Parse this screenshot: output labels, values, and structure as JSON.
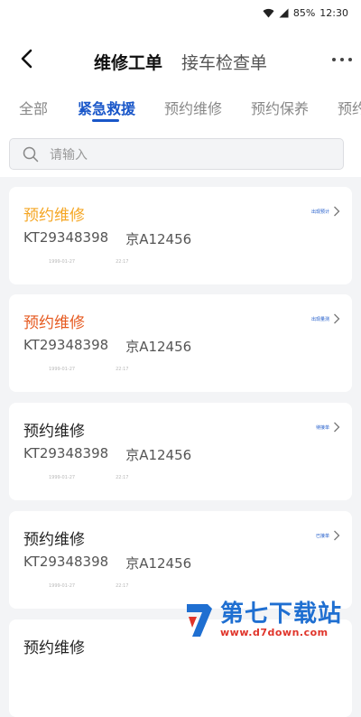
{
  "status_bar": {
    "battery": "85%",
    "time": "12:30"
  },
  "header": {
    "title": "维修工单",
    "alt_title": "接车检查单"
  },
  "tabs": [
    {
      "label": "全部"
    },
    {
      "label": "紧急救援"
    },
    {
      "label": "预约维修"
    },
    {
      "label": "预约保养"
    },
    {
      "label": "预约"
    }
  ],
  "search": {
    "placeholder": "请输入",
    "value": ""
  },
  "cards": [
    {
      "title": "预约维修",
      "order_no": "KT29348398",
      "plate": "京A12456",
      "date": "1999-01-27",
      "time": "22:17",
      "status": "出现预计"
    },
    {
      "title": "预约维修",
      "order_no": "KT29348398",
      "plate": "京A12456",
      "date": "1999-01-27",
      "time": "22:17",
      "status": "出现量测"
    },
    {
      "title": "预约维修",
      "order_no": "KT29348398",
      "plate": "京A12456",
      "date": "1999-01-27",
      "time": "22:17",
      "status": "待接单"
    },
    {
      "title": "预约维修",
      "order_no": "KT29348398",
      "plate": "京A12456",
      "date": "1999-01-27",
      "time": "22:17",
      "status": "已接单"
    },
    {
      "title": "预约维修"
    }
  ],
  "watermark": {
    "name": "第七下载站",
    "url": "www.d7down.com"
  },
  "colors": {
    "accent": "#1a57c9",
    "orange": "#f5a623",
    "red_orange": "#e65a20"
  }
}
